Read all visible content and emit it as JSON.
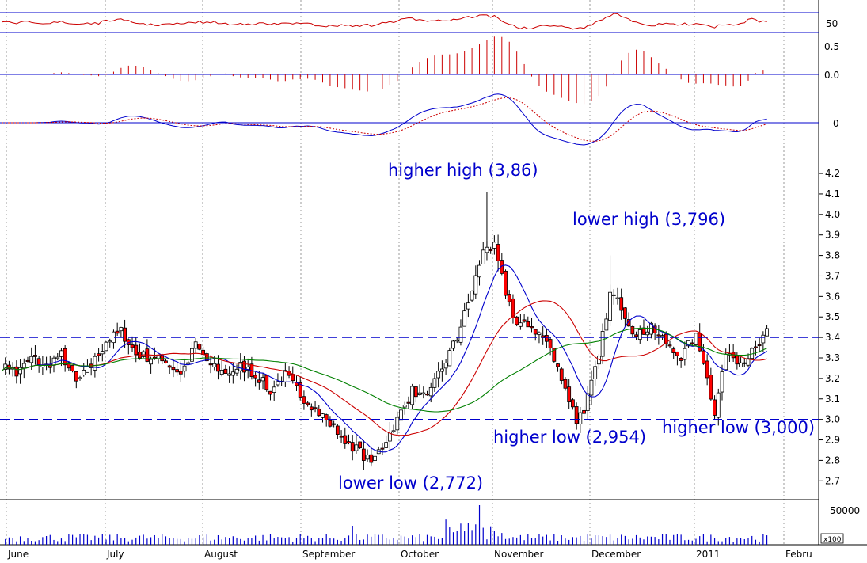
{
  "chart_data": {
    "type": "candlestick",
    "colors": {
      "up": "#ffffff",
      "down": "#ff0000",
      "ma_fast": "#0000cc",
      "ma_mid": "#cc0000",
      "ma_slow": "#008000",
      "annotation": "#0000cc",
      "volume": "#0000cc",
      "grid": "#9a9a9a"
    },
    "months": [
      "June",
      "July",
      "August",
      "September",
      "October",
      "November",
      "December",
      "2011",
      "Febru"
    ],
    "price_axis": {
      "ylim": [
        2.62,
        4.32
      ],
      "ticks": [
        "2.7",
        "2.8",
        "2.9",
        "3.0",
        "3.1",
        "3.2",
        "3.3",
        "3.4",
        "3.5",
        "3.6",
        "3.7",
        "3.8",
        "3.9",
        "4.0",
        "4.1",
        "4.2"
      ]
    },
    "horizontal_levels": [
      3.4,
      3.0
    ],
    "annotations": [
      {
        "text": "higher high (3,86)",
        "x": 1.6,
        "y": 4.15
      },
      {
        "text": "lower high (3,796)",
        "x": 2.6,
        "y": 3.86
      },
      {
        "text": "lower low (2,772)",
        "x": 1.45,
        "y": 2.72
      },
      {
        "text": "higher low (2,954)",
        "x": 2.3,
        "y": 2.89
      },
      {
        "text": "higher low (3,000)",
        "x": 3.1,
        "y": 2.92
      }
    ],
    "anchors": [
      [
        0,
        3.26
      ],
      [
        1,
        3.28
      ],
      [
        4,
        3.22
      ],
      [
        8,
        3.3
      ],
      [
        12,
        3.26
      ],
      [
        16,
        3.32
      ],
      [
        20,
        3.18
      ],
      [
        24,
        3.26
      ],
      [
        28,
        3.38
      ],
      [
        32,
        3.43
      ],
      [
        36,
        3.32
      ],
      [
        40,
        3.3
      ],
      [
        44,
        3.28
      ],
      [
        48,
        3.22
      ],
      [
        52,
        3.36
      ],
      [
        56,
        3.26
      ],
      [
        60,
        3.22
      ],
      [
        64,
        3.26
      ],
      [
        68,
        3.22
      ],
      [
        72,
        3.14
      ],
      [
        76,
        3.22
      ],
      [
        80,
        3.12
      ],
      [
        84,
        3.05
      ],
      [
        88,
        2.98
      ],
      [
        92,
        2.9
      ],
      [
        96,
        2.84
      ],
      [
        99,
        2.79
      ],
      [
        102,
        2.87
      ],
      [
        106,
        3.0
      ],
      [
        110,
        3.14
      ],
      [
        114,
        3.1
      ],
      [
        118,
        3.25
      ],
      [
        122,
        3.4
      ],
      [
        126,
        3.62
      ],
      [
        129,
        3.83
      ],
      [
        132,
        3.84
      ],
      [
        135,
        3.62
      ],
      [
        138,
        3.46
      ],
      [
        142,
        3.45
      ],
      [
        146,
        3.38
      ],
      [
        150,
        3.2
      ],
      [
        154,
        3.0
      ],
      [
        156,
        3.05
      ],
      [
        160,
        3.3
      ],
      [
        163,
        3.62
      ],
      [
        166,
        3.55
      ],
      [
        170,
        3.4
      ],
      [
        174,
        3.46
      ],
      [
        178,
        3.36
      ],
      [
        182,
        3.3
      ],
      [
        186,
        3.42
      ],
      [
        189,
        3.22
      ],
      [
        191,
        3.02
      ],
      [
        194,
        3.34
      ],
      [
        198,
        3.28
      ],
      [
        202,
        3.34
      ],
      [
        205,
        3.42
      ]
    ],
    "volume_axis": {
      "tick": "50000",
      "multiplier": "x100"
    },
    "rsi_axis": {
      "tick": "50"
    },
    "osc1_axis": {
      "ticks": [
        "0.5",
        "0.0"
      ]
    },
    "osc2_axis": {
      "tick": "0"
    }
  }
}
